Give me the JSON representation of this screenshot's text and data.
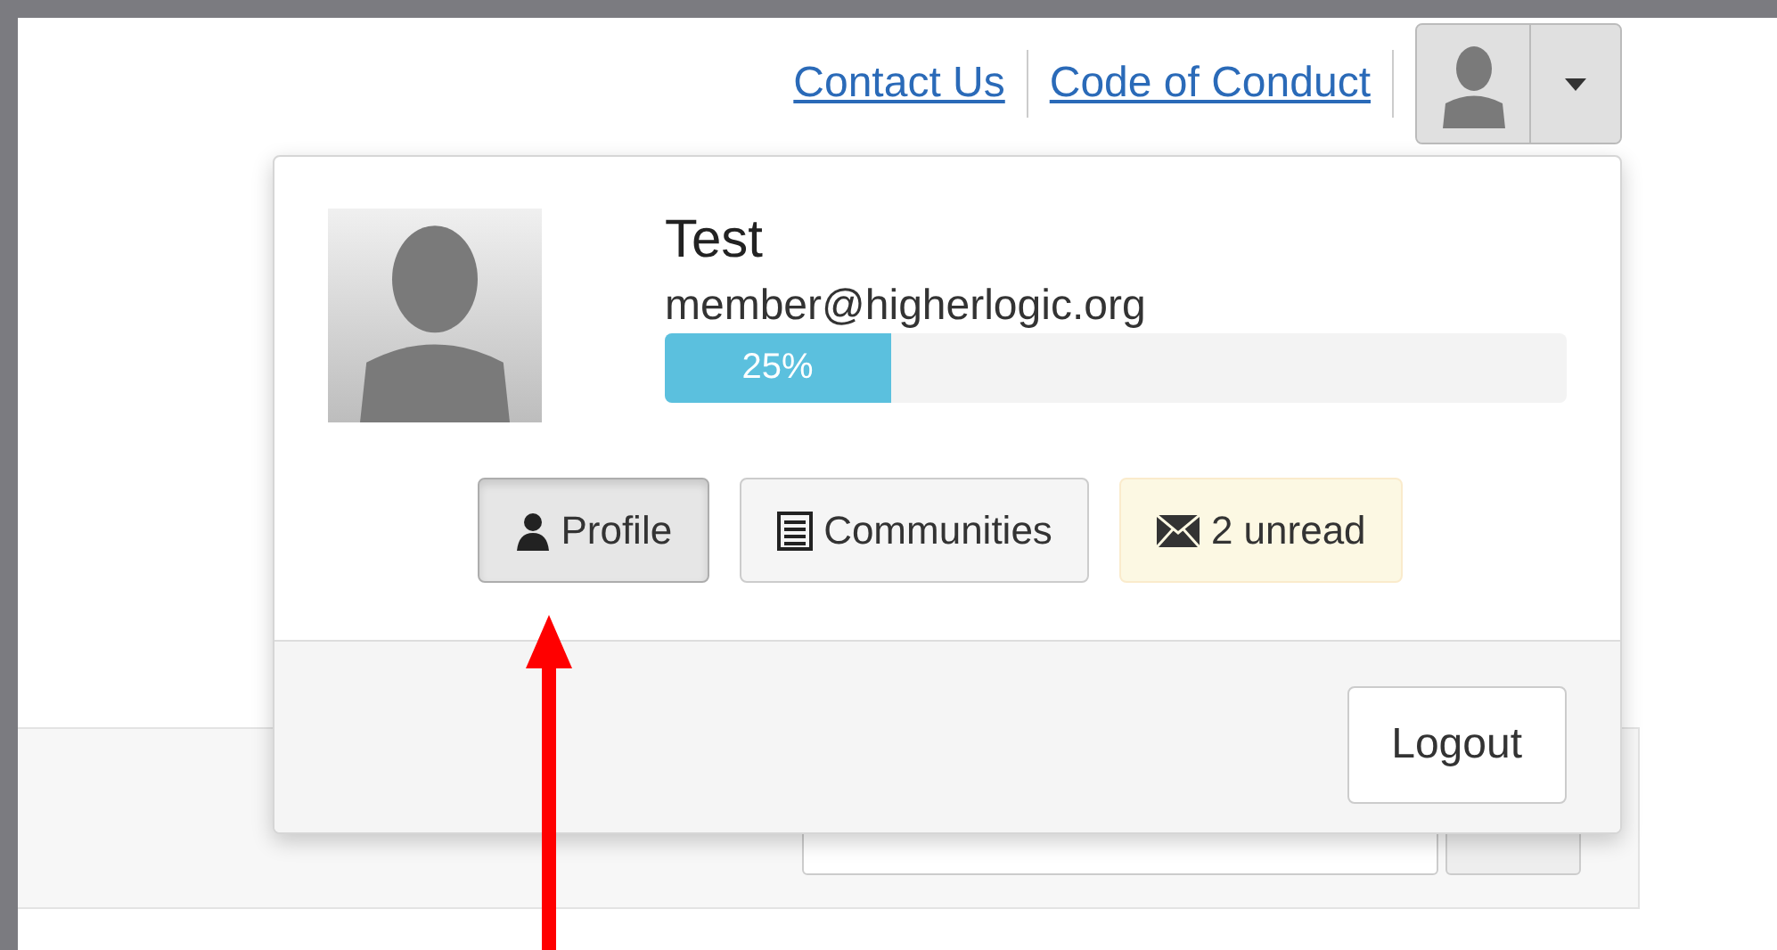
{
  "header": {
    "links": [
      "Contact Us",
      "Code of Conduct"
    ]
  },
  "menu": {
    "open": true,
    "user": {
      "name": "Test",
      "email": "member@higherlogic.org",
      "level": 0.25,
      "level_label": "25%"
    },
    "actions": [
      {
        "label": "Profile",
        "kind": "profile",
        "selected": true
      },
      {
        "label": "Communities",
        "kind": "communities",
        "selected": false
      },
      {
        "label": "2 unread",
        "kind": "messages",
        "selected": false
      }
    ],
    "logout": "Logout"
  },
  "annotation": {
    "kind": "arrow"
  }
}
